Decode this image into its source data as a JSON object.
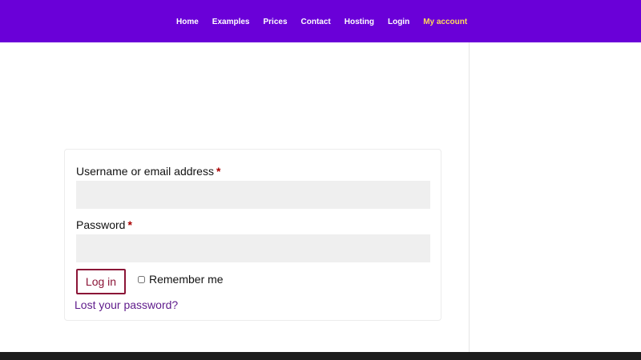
{
  "nav": {
    "items": [
      {
        "label": "Home"
      },
      {
        "label": "Examples"
      },
      {
        "label": "Prices"
      },
      {
        "label": "Contact"
      },
      {
        "label": "Hosting"
      },
      {
        "label": "Login"
      },
      {
        "label": "My account",
        "active": true
      }
    ]
  },
  "login_form": {
    "username_label": "Username or email address",
    "password_label": "Password",
    "required_marker": "*",
    "username_value": "",
    "password_value": "",
    "login_button_label": "Log in",
    "remember_label": "Remember me",
    "remember_checked": false,
    "lost_password_label": "Lost your password?"
  },
  "colors": {
    "header_bg": "#6a00d8",
    "nav_text": "#ffffff",
    "nav_active": "#ffd95a",
    "button_border": "#8b1537",
    "link": "#5e1a8b",
    "footer_bg": "#1c1c1c"
  }
}
